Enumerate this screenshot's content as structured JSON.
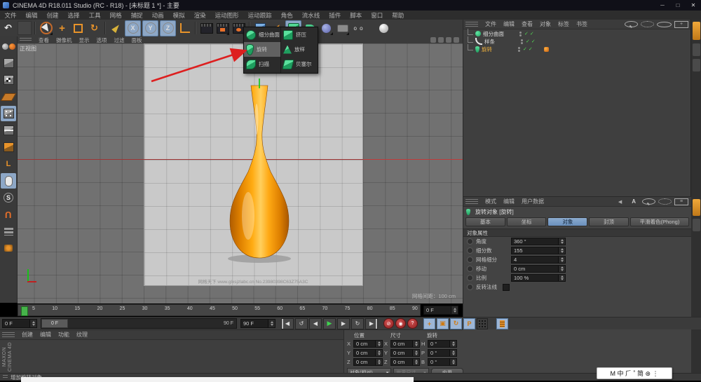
{
  "window": {
    "title": "CINEMA 4D R18.011 Studio (RC - R18) - [未标题 1 *] - 主要",
    "minimize": "─",
    "maximize": "□",
    "close": "✕"
  },
  "menu_bar": {
    "items": [
      {
        "label": "文件"
      },
      {
        "label": "编辑"
      },
      {
        "label": "创建"
      },
      {
        "label": "选择"
      },
      {
        "label": "工具"
      },
      {
        "label": "网格"
      },
      {
        "label": "捕捉"
      },
      {
        "label": "动画"
      },
      {
        "label": "模拟"
      },
      {
        "label": "渲染"
      },
      {
        "label": "运动图形"
      },
      {
        "label": "运动跟踪"
      },
      {
        "label": "角色"
      },
      {
        "label": "流水线"
      },
      {
        "label": "插件"
      },
      {
        "label": "脚本"
      },
      {
        "label": "窗口"
      },
      {
        "label": "帮助"
      }
    ]
  },
  "toolbar": {
    "undo": "↶",
    "axis_x": "X",
    "axis_y": "Y",
    "axis_z": "Z"
  },
  "left_toolbar": {
    "axis_label": "L",
    "snap_label": "S",
    "magnet_label": "U"
  },
  "generator_menu": {
    "left": [
      {
        "label": "细分曲面",
        "icon": "subdiv",
        "selected": false
      },
      {
        "label": "旋转",
        "icon": "lathe",
        "selected": true
      },
      {
        "label": "扫描",
        "icon": "sweep",
        "selected": false
      }
    ],
    "right": [
      {
        "label": "挤压",
        "icon": "extrude",
        "selected": false
      },
      {
        "label": "放样",
        "icon": "loft",
        "selected": false
      },
      {
        "label": "贝塞尔",
        "icon": "bezier",
        "selected": false
      }
    ]
  },
  "viewport": {
    "menu": [
      {
        "label": "查看"
      },
      {
        "label": "摄像机"
      },
      {
        "label": "显示"
      },
      {
        "label": "选项"
      },
      {
        "label": "过滤"
      },
      {
        "label": "面板"
      }
    ],
    "view_label": "正视图",
    "watermark": "网格天下 www.glxsjzlabc.cn  No.23980398C63Z75A3C",
    "grid_label": "网格间距：100 cm"
  },
  "object_manager": {
    "menu": [
      {
        "label": "文件"
      },
      {
        "label": "编辑"
      },
      {
        "label": "查看"
      },
      {
        "label": "对象"
      },
      {
        "label": "标签"
      },
      {
        "label": "书签"
      }
    ],
    "objects": [
      {
        "name": "细分曲面",
        "icon": "subdiv",
        "selected": false,
        "has_tag": false
      },
      {
        "name": "样条",
        "icon": "spline",
        "selected": false,
        "has_tag": false
      },
      {
        "name": "旋转",
        "icon": "lathe",
        "selected": true,
        "has_tag": true
      }
    ],
    "check": "✓"
  },
  "attributes": {
    "menu": [
      {
        "label": "模式"
      },
      {
        "label": "编辑"
      },
      {
        "label": "用户数据"
      }
    ],
    "back_icon": "◀",
    "a_icon": "A",
    "object_title": "旋转对象 [旋转]",
    "tabs": [
      {
        "label": "基本",
        "active": false
      },
      {
        "label": "坐标",
        "active": false
      },
      {
        "label": "对象",
        "active": true
      },
      {
        "label": "封顶",
        "active": false
      },
      {
        "label": "平滑着色(Phong)",
        "active": false,
        "wide": true
      }
    ],
    "section_title": "对象属性",
    "fields": [
      {
        "label": "角度",
        "value": "360 °"
      },
      {
        "label": "细分数",
        "value": "155"
      },
      {
        "label": "网格细分",
        "value": "4"
      },
      {
        "label": "移动",
        "value": "0 cm"
      },
      {
        "label": "比例",
        "value": "100 %"
      }
    ],
    "checkbox_label": "反转法线"
  },
  "timeline": {
    "ticks": [
      {
        "t": "5"
      },
      {
        "t": "10"
      },
      {
        "t": "15"
      },
      {
        "t": "20"
      },
      {
        "t": "25"
      },
      {
        "t": "30"
      },
      {
        "t": "35"
      },
      {
        "t": "40"
      },
      {
        "t": "45"
      },
      {
        "t": "50"
      },
      {
        "t": "55"
      },
      {
        "t": "60"
      },
      {
        "t": "65"
      },
      {
        "t": "70"
      },
      {
        "t": "75"
      },
      {
        "t": "80"
      },
      {
        "t": "85"
      },
      {
        "t": "90"
      }
    ],
    "frame_field": "0 F"
  },
  "transport": {
    "current_frame": "0 F",
    "scrub_handle": "0 F",
    "scrub_end": "90 F",
    "range_end": "90 F",
    "goto_start": "◀",
    "play_back": "↺",
    "step_back": "◀",
    "play": "▶",
    "step_fwd": "▶",
    "loop": "↻",
    "goto_end": "▶",
    "rec1": "⊘",
    "rec2": "◉",
    "rec3": "?",
    "key_pos": "+",
    "key_scale": "▣",
    "key_rot": "↻",
    "key_param": "P"
  },
  "materials": {
    "menu": [
      {
        "label": "创建"
      },
      {
        "label": "编辑"
      },
      {
        "label": "功能"
      },
      {
        "label": "纹理"
      }
    ],
    "brand_line1": "MAXON",
    "brand_line2": "CINEMA 4D"
  },
  "coordinates": {
    "headers": [
      {
        "label": "位置"
      },
      {
        "label": "尺寸"
      },
      {
        "label": "旋转"
      }
    ],
    "cells": [
      {
        "axis": "X",
        "value": "0 cm"
      },
      {
        "axis": "X",
        "value": "0 cm"
      },
      {
        "axis": "H",
        "value": "0 °"
      },
      {
        "axis": "Y",
        "value": "0 cm"
      },
      {
        "axis": "Y",
        "value": "0 cm"
      },
      {
        "axis": "P",
        "value": "0 °"
      },
      {
        "axis": "Z",
        "value": "0 cm"
      },
      {
        "axis": "Z",
        "value": "0 cm"
      },
      {
        "axis": "B",
        "value": "0 °"
      }
    ],
    "mode_dropdown": "对象(相对)",
    "size_dropdown": "世界尺寸",
    "apply_button": "应用",
    "dd_arrow": "▾"
  },
  "status_bar": {
    "text": "增加旋转对象"
  },
  "ime": {
    "text": "M 中 ⺁ ˚ 简 ⊛ ⋮"
  },
  "colors": {
    "accent_orange": "#e8932a",
    "selected_blue": "#6a90bd",
    "generator_green": "#2fbf75",
    "axis_red": "#9e3434"
  }
}
